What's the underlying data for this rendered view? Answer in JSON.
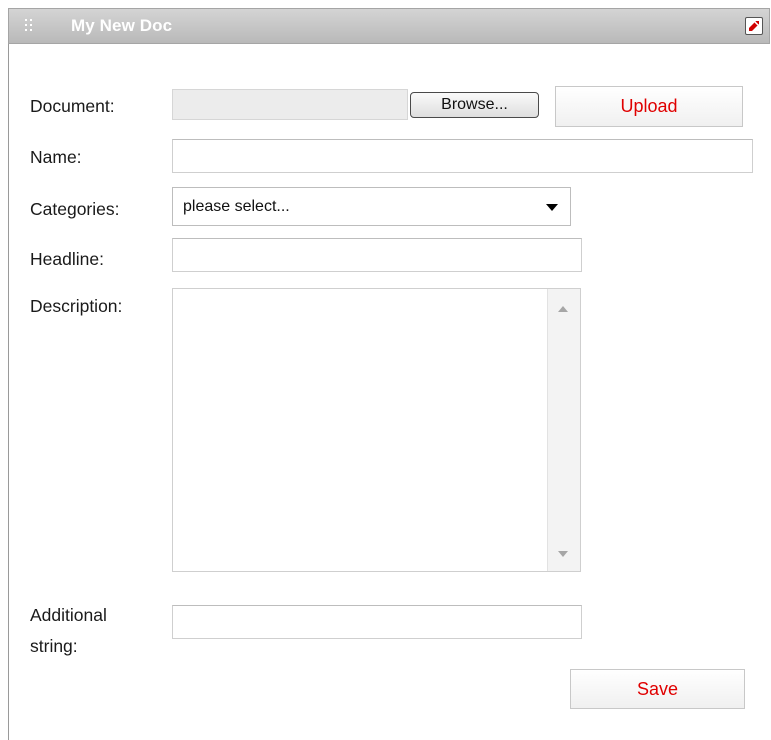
{
  "window": {
    "title": "My New Doc"
  },
  "form": {
    "document": {
      "label": "Document:",
      "value": "",
      "browse_label": "Browse...",
      "upload_label": "Upload"
    },
    "name": {
      "label": "Name:",
      "value": ""
    },
    "categories": {
      "label": "Categories:",
      "selected": "please select..."
    },
    "headline": {
      "label": "Headline:",
      "value": ""
    },
    "description": {
      "label": "Description:",
      "value": ""
    },
    "additional": {
      "label_line1": "Additional",
      "label_line2": "string:",
      "value": ""
    },
    "save_label": "Save"
  },
  "colors": {
    "titlebar": "#c7c7c7",
    "action_text": "#e00000",
    "border": "#cfcfcf"
  },
  "icons": {
    "drag": "drag-handle-icon",
    "close": "close-icon",
    "dropdown": "chevron-down-icon"
  }
}
